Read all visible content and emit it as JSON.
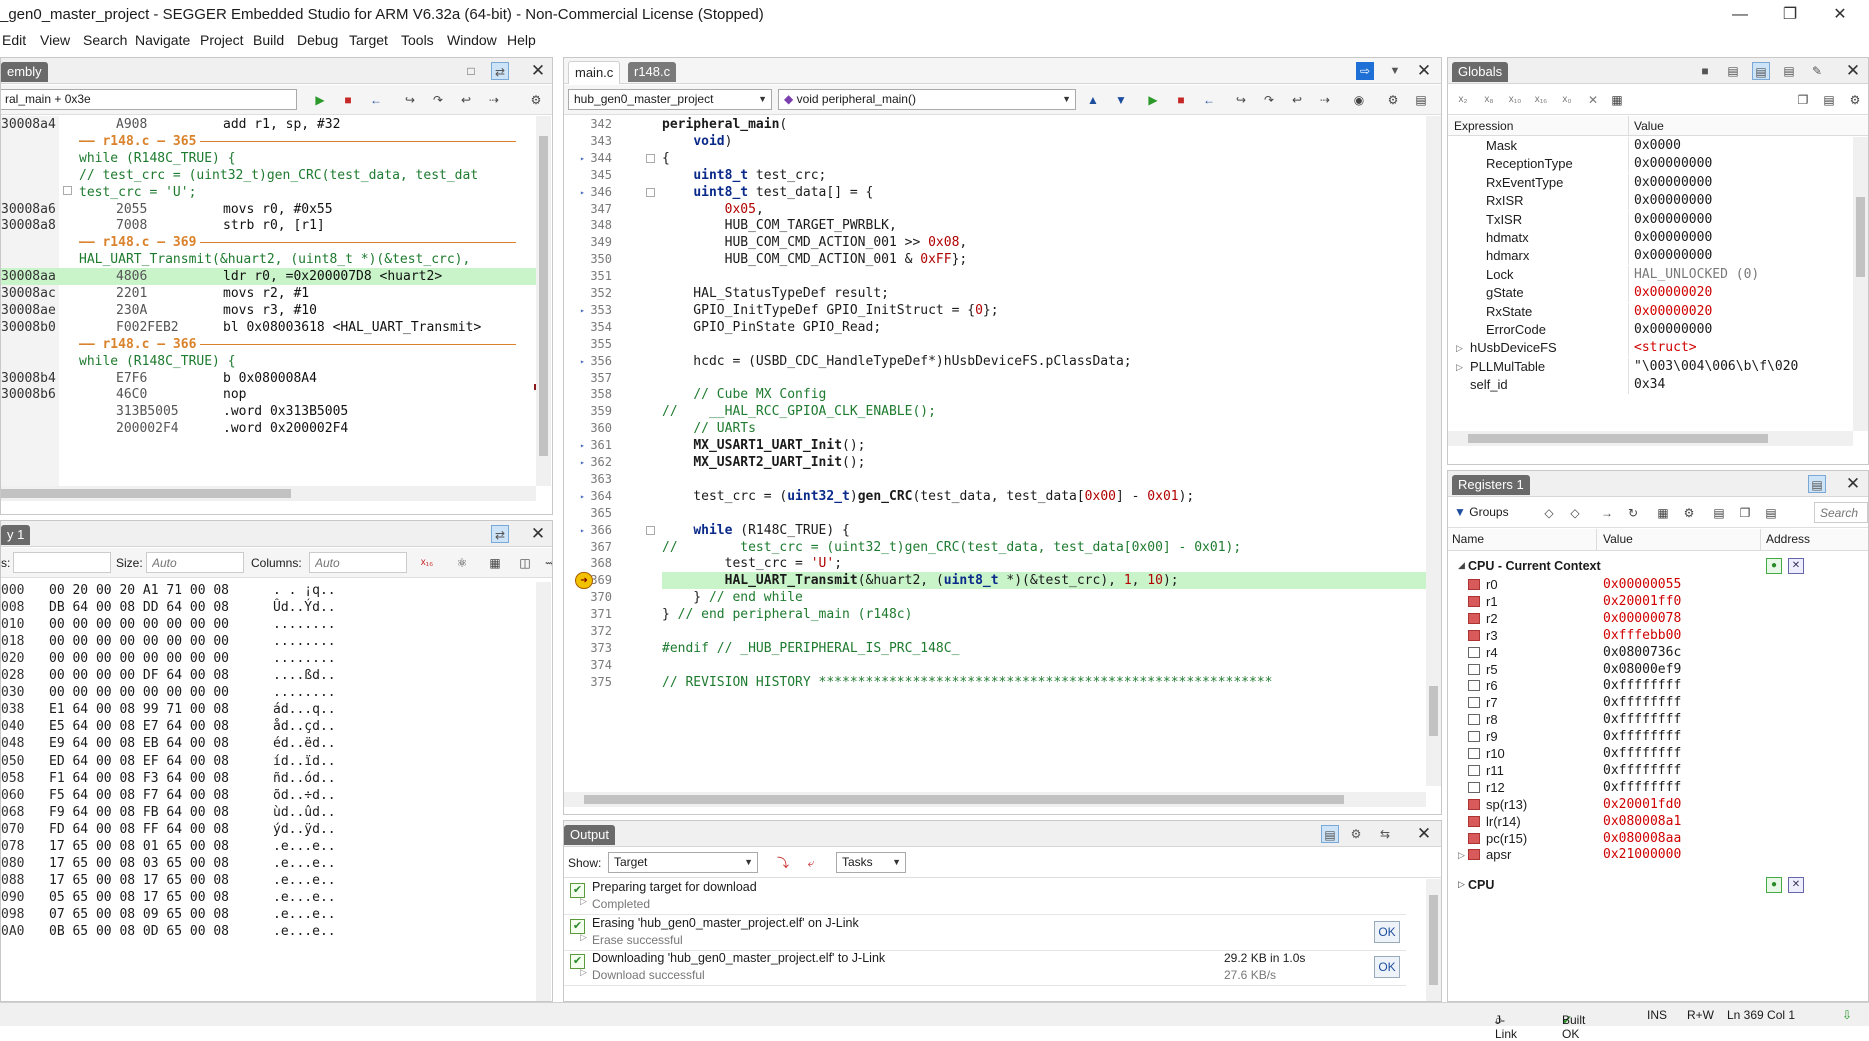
{
  "window": {
    "title": "_gen0_master_project - SEGGER Embedded Studio for ARM V6.32a (64-bit) - Non-Commercial License (Stopped)"
  },
  "menu": [
    "Edit",
    "View",
    "Search",
    "Navigate",
    "Project",
    "Build",
    "Debug",
    "Target",
    "Tools",
    "Window",
    "Help"
  ],
  "disassembly": {
    "tab": "embly",
    "location": "ral_main + 0x3e",
    "lines": [
      {
        "addr": "30008a4",
        "hex": "A908",
        "text": "add r1, sp, #32",
        "kind": "asm"
      },
      {
        "addr": "",
        "hex": "",
        "text": "—— r148.c — 365",
        "kind": "sep"
      },
      {
        "addr": "",
        "hex": "",
        "text": "while (R148C_TRUE) {",
        "kind": "src"
      },
      {
        "addr": "",
        "hex": "",
        "text": "// test_crc = (uint32_t)gen_CRC(test_data, test_dat",
        "kind": "src"
      },
      {
        "addr": "",
        "hex": "",
        "text": "test_crc = 'U';",
        "kind": "src"
      },
      {
        "addr": "30008a6",
        "hex": "2055",
        "text": "movs r0, #0x55",
        "kind": "asm"
      },
      {
        "addr": "30008a8",
        "hex": "7008",
        "text": "strb r0, [r1]",
        "kind": "asm"
      },
      {
        "addr": "",
        "hex": "",
        "text": "—— r148.c — 369",
        "kind": "sep"
      },
      {
        "addr": "",
        "hex": "",
        "text": "HAL_UART_Transmit(&huart2, (uint8_t *)(&test_crc),",
        "kind": "src"
      },
      {
        "addr": "30008aa",
        "hex": "4806",
        "text": "ldr r0, =0x200007D8 <huart2>",
        "kind": "cur"
      },
      {
        "addr": "30008ac",
        "hex": "2201",
        "text": "movs r2, #1",
        "kind": "asm"
      },
      {
        "addr": "30008ae",
        "hex": "230A",
        "text": "movs r3, #10",
        "kind": "asm"
      },
      {
        "addr": "30008b0",
        "hex": "F002FEB2",
        "text": "bl 0x08003618 <HAL_UART_Transmit>",
        "kind": "asm"
      },
      {
        "addr": "",
        "hex": "",
        "text": "—— r148.c — 366",
        "kind": "sep"
      },
      {
        "addr": "",
        "hex": "",
        "text": "while (R148C_TRUE) {",
        "kind": "src"
      },
      {
        "addr": "30008b4",
        "hex": "E7F6",
        "text": "b 0x080008A4",
        "kind": "asm"
      },
      {
        "addr": "30008b6",
        "hex": "46C0",
        "text": "nop",
        "kind": "asm"
      },
      {
        "addr": "",
        "hex": "313B5005",
        "text": ".word 0x313B5005",
        "kind": "asm"
      },
      {
        "addr": "",
        "hex": "200002F4",
        "text": ".word 0x200002F4",
        "kind": "asm"
      }
    ]
  },
  "memory": {
    "tab": "y 1",
    "labels": {
      "addr": "s:",
      "size": "Size:",
      "cols": "Columns:"
    },
    "placeholders": {
      "size": "Auto",
      "cols": "Auto"
    },
    "rows": [
      {
        "a": "000",
        "h": "00 20 00 20 A1 71 00 08",
        "t": ". . ¡q.."
      },
      {
        "a": "008",
        "h": "DB 64 00 08 DD 64 00 08",
        "t": "Ûd..Ýd.."
      },
      {
        "a": "010",
        "h": "00 00 00 00 00 00 00 00",
        "t": "........"
      },
      {
        "a": "018",
        "h": "00 00 00 00 00 00 00 00",
        "t": "........"
      },
      {
        "a": "020",
        "h": "00 00 00 00 00 00 00 00",
        "t": "........"
      },
      {
        "a": "028",
        "h": "00 00 00 00 DF 64 00 08",
        "t": "....ßd.."
      },
      {
        "a": "030",
        "h": "00 00 00 00 00 00 00 00",
        "t": "........"
      },
      {
        "a": "038",
        "h": "E1 64 00 08 99 71 00 08",
        "t": "ád...q.."
      },
      {
        "a": "040",
        "h": "E5 64 00 08 E7 64 00 08",
        "t": "åd..çd.."
      },
      {
        "a": "048",
        "h": "E9 64 00 08 EB 64 00 08",
        "t": "éd..ëd.."
      },
      {
        "a": "050",
        "h": "ED 64 00 08 EF 64 00 08",
        "t": "íd..ïd.."
      },
      {
        "a": "058",
        "h": "F1 64 00 08 F3 64 00 08",
        "t": "ñd..ód.."
      },
      {
        "a": "060",
        "h": "F5 64 00 08 F7 64 00 08",
        "t": "õd..÷d.."
      },
      {
        "a": "068",
        "h": "F9 64 00 08 FB 64 00 08",
        "t": "ùd..ûd.."
      },
      {
        "a": "070",
        "h": "FD 64 00 08 FF 64 00 08",
        "t": "ýd..ÿd.."
      },
      {
        "a": "078",
        "h": "17 65 00 08 01 65 00 08",
        "t": ".e...e.."
      },
      {
        "a": "080",
        "h": "17 65 00 08 03 65 00 08",
        "t": ".e...e.."
      },
      {
        "a": "088",
        "h": "17 65 00 08 17 65 00 08",
        "t": ".e...e.."
      },
      {
        "a": "090",
        "h": "05 65 00 08 17 65 00 08",
        "t": ".e...e.."
      },
      {
        "a": "098",
        "h": "07 65 00 08 09 65 00 08",
        "t": ".e...e.."
      },
      {
        "a": "0A0",
        "h": "0B 65 00 08 0D 65 00 08",
        "t": ".e...e.."
      }
    ]
  },
  "editor": {
    "tabs": [
      "main.c",
      "r148.c"
    ],
    "project_combo": "hub_gen0_master_project",
    "function_combo": "void peripheral_main()",
    "lines": [
      {
        "n": "342",
        "html": "<span class=\"fn\">peripheral_main</span>("
      },
      {
        "n": "343",
        "html": "    <span class=\"kw\">void</span>)"
      },
      {
        "n": "344",
        "html": "{"
      },
      {
        "n": "345",
        "html": "    <span class=\"kw\">uint8_t</span> test_crc;"
      },
      {
        "n": "346",
        "html": "    <span class=\"kw\">uint8_t</span> test_data[] = {"
      },
      {
        "n": "347",
        "html": "        <span class=\"num\">0x05</span>,"
      },
      {
        "n": "348",
        "html": "        HUB_COM_TARGET_PWRBLK,"
      },
      {
        "n": "349",
        "html": "        HUB_COM_CMD_ACTION_001 &gt;&gt; <span class=\"num\">0x08</span>,"
      },
      {
        "n": "350",
        "html": "        HUB_COM_CMD_ACTION_001 &amp; <span class=\"num\">0xFF</span>};"
      },
      {
        "n": "351",
        "html": ""
      },
      {
        "n": "352",
        "html": "    HAL_StatusTypeDef result;"
      },
      {
        "n": "353",
        "html": "    GPIO_InitTypeDef GPIO_InitStruct = {<span class=\"num\">0</span>};"
      },
      {
        "n": "354",
        "html": "    GPIO_PinState GPIO_Read;"
      },
      {
        "n": "355",
        "html": ""
      },
      {
        "n": "356",
        "html": "    hcdc = (USBD_CDC_HandleTypeDef*)hUsbDeviceFS.pClassData;"
      },
      {
        "n": "357",
        "html": ""
      },
      {
        "n": "358",
        "html": "    <span class=\"cm\">// Cube MX Config</span>"
      },
      {
        "n": "359",
        "html": "<span class=\"cm\">//    __HAL_RCC_GPIOA_CLK_ENABLE();</span>"
      },
      {
        "n": "360",
        "html": "    <span class=\"cm\">// UARTs</span>"
      },
      {
        "n": "361",
        "html": "    <span class=\"fn\">MX_USART1_UART_Init</span>();"
      },
      {
        "n": "362",
        "html": "    <span class=\"fn\">MX_USART2_UART_Init</span>();"
      },
      {
        "n": "363",
        "html": ""
      },
      {
        "n": "364",
        "html": "    test_crc = (<span class=\"kw\">uint32_t</span>)<span class=\"fn\">gen_CRC</span>(test_data, test_data[<span class=\"num\">0x00</span>] - <span class=\"num\">0x01</span>);"
      },
      {
        "n": "365",
        "html": ""
      },
      {
        "n": "366",
        "html": "    <span class=\"kw\">while</span> (R148C_TRUE) {"
      },
      {
        "n": "367",
        "html": "<span class=\"cm\">//        test_crc = (uint32_t)gen_CRC(test_data, test_data[0x00] - 0x01);</span>"
      },
      {
        "n": "368",
        "html": "        test_crc = <span class=\"num\">'U'</span>;"
      },
      {
        "n": "369",
        "html": "        <span class=\"fn\">HAL_UART_Transmit</span>(&amp;huart2, (<span class=\"kw\">uint8_t</span> *)(&amp;test_crc), <span class=\"num\">1</span>, <span class=\"num\">10</span>);"
      },
      {
        "n": "370",
        "html": "    } <span class=\"cm\">// end while</span>"
      },
      {
        "n": "371",
        "html": "} <span class=\"cm\">// end peripheral_main (r148c)</span>"
      },
      {
        "n": "372",
        "html": ""
      },
      {
        "n": "373",
        "html": "<span class=\"pre\">#endif // _HUB_PERIPHERAL_IS_PRC_148C_</span>"
      },
      {
        "n": "374",
        "html": ""
      },
      {
        "n": "375",
        "html": "<span class=\"cm\">// REVISION HISTORY **********************************************************</span>"
      }
    ]
  },
  "output": {
    "tab": "Output",
    "show_label": "Show:",
    "show_value": "Target",
    "tasks_value": "Tasks",
    "items": [
      {
        "title": "Preparing target for download",
        "sub": "Completed",
        "size": "",
        "rate": "",
        "ok": false
      },
      {
        "title": "Erasing 'hub_gen0_master_project.elf' on J-Link",
        "sub": "Erase successful",
        "size": "",
        "rate": "",
        "ok": true
      },
      {
        "title": "Downloading 'hub_gen0_master_project.elf' to J-Link",
        "sub": "Download successful",
        "size": "29.2 KB in 1.0s",
        "rate": "27.6 KB/s",
        "ok": true
      }
    ],
    "ok_label": "OK"
  },
  "globals": {
    "tab": "Globals",
    "col_expr": "Expression",
    "col_value": "Value",
    "rows": [
      {
        "name": "Mask",
        "value": "0x0000",
        "indent": 2,
        "color": "normal",
        "exp": false
      },
      {
        "name": "ReceptionType",
        "value": "0x00000000",
        "indent": 2,
        "color": "normal",
        "exp": false
      },
      {
        "name": "RxEventType",
        "value": "0x00000000",
        "indent": 2,
        "color": "normal",
        "exp": false
      },
      {
        "name": "RxISR",
        "value": "0x00000000",
        "indent": 2,
        "color": "normal",
        "exp": false
      },
      {
        "name": "TxISR",
        "value": "0x00000000",
        "indent": 2,
        "color": "normal",
        "exp": false
      },
      {
        "name": "hdmatx",
        "value": "0x00000000",
        "indent": 2,
        "color": "normal",
        "exp": false
      },
      {
        "name": "hdmarx",
        "value": "0x00000000",
        "indent": 2,
        "color": "normal",
        "exp": false
      },
      {
        "name": "Lock",
        "value": "HAL_UNLOCKED (0)",
        "indent": 2,
        "color": "gray",
        "exp": false
      },
      {
        "name": "gState",
        "value": "0x00000020",
        "indent": 2,
        "color": "red",
        "exp": false
      },
      {
        "name": "RxState",
        "value": "0x00000020",
        "indent": 2,
        "color": "red",
        "exp": false
      },
      {
        "name": "ErrorCode",
        "value": "0x00000000",
        "indent": 2,
        "color": "normal",
        "exp": false
      },
      {
        "name": "hUsbDeviceFS",
        "value": "<struct>",
        "indent": 1,
        "color": "red",
        "exp": true
      },
      {
        "name": "PLLMulTable",
        "value": "\"\\003\\004\\006\\b\\f\\020",
        "indent": 1,
        "color": "normal",
        "exp": true
      },
      {
        "name": "self_id",
        "value": "0x34",
        "indent": 1,
        "color": "normal",
        "exp": false
      }
    ]
  },
  "registers": {
    "tab": "Registers 1",
    "groups_label": "Groups",
    "search_placeholder": "Search",
    "col_name": "Name",
    "col_value": "Value",
    "col_addr": "Address",
    "group1": "CPU - Current Context",
    "group2": "CPU",
    "rows": [
      {
        "name": "r0",
        "value": "0x00000055",
        "chg": true
      },
      {
        "name": "r1",
        "value": "0x20001ff0",
        "chg": true
      },
      {
        "name": "r2",
        "value": "0x00000078",
        "chg": true
      },
      {
        "name": "r3",
        "value": "0xfffebb00",
        "chg": true
      },
      {
        "name": "r4",
        "value": "0x0800736c",
        "chg": false
      },
      {
        "name": "r5",
        "value": "0x08000ef9",
        "chg": false
      },
      {
        "name": "r6",
        "value": "0xffffffff",
        "chg": false
      },
      {
        "name": "r7",
        "value": "0xffffffff",
        "chg": false
      },
      {
        "name": "r8",
        "value": "0xffffffff",
        "chg": false
      },
      {
        "name": "r9",
        "value": "0xffffffff",
        "chg": false
      },
      {
        "name": "r10",
        "value": "0xffffffff",
        "chg": false
      },
      {
        "name": "r11",
        "value": "0xffffffff",
        "chg": false
      },
      {
        "name": "r12",
        "value": "0xffffffff",
        "chg": false
      },
      {
        "name": "sp(r13)",
        "value": "0x20001fd0",
        "chg": true
      },
      {
        "name": "lr(r14)",
        "value": "0x080008a1",
        "chg": true
      },
      {
        "name": "pc(r15)",
        "value": "0x080008aa",
        "chg": true
      },
      {
        "name": "apsr",
        "value": "0x21000000",
        "chg": true
      }
    ]
  },
  "statusbar": {
    "jlink": "J-Link",
    "build": "Built OK",
    "ins": "INS",
    "rw": "R+W",
    "pos": "Ln 369 Col 1"
  },
  "colors": {
    "accent": "#1e4f9f",
    "changed": "#d00000",
    "current_line": "#c9f3c9",
    "tab_bg": "#6a6a6a"
  }
}
